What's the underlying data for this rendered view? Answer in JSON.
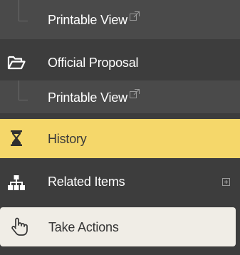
{
  "nav": {
    "items": [
      {
        "label": "Printable View"
      },
      {
        "label": "Official Proposal",
        "icon": "folder-open-icon"
      },
      {
        "label": "Printable View"
      },
      {
        "label": "History",
        "icon": "hourglass-icon"
      },
      {
        "label": "Related Items",
        "icon": "sitemap-icon",
        "expand": "plus-box-icon"
      },
      {
        "label": "Take Actions",
        "icon": "hand-pointer-icon"
      }
    ]
  },
  "colors": {
    "sidebar_bg": "#3d3d3d",
    "subitem_bg": "#4a4a4a",
    "active_bg": "#f5d76a",
    "take_actions_bg": "#f0ede6"
  }
}
